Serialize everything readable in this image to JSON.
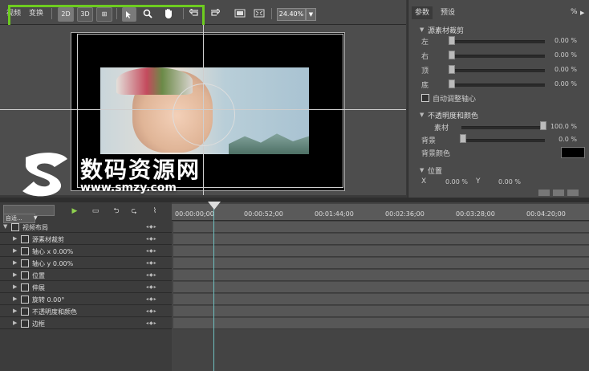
{
  "toolbar": {
    "tabs": [
      "视频",
      "变换"
    ],
    "buttons": [
      "2D",
      "3D",
      "⊞"
    ],
    "zoom": "24.40%"
  },
  "right_panel": {
    "tabs": [
      "参数",
      "预设"
    ],
    "pct_header": "%",
    "crop_section": "源素材裁剪",
    "crop_rows": [
      {
        "label": "左",
        "value": "0.00 %"
      },
      {
        "label": "右",
        "value": "0.00 %"
      },
      {
        "label": "顶",
        "value": "0.00 %"
      },
      {
        "label": "底",
        "value": "0.00 %"
      }
    ],
    "auto_center": "自动调整轴心",
    "opacity_section": "不透明度和颜色",
    "opacity_rows": [
      {
        "label": "素材",
        "value": "100.0 %"
      },
      {
        "label": "背景",
        "value": "0.0 %"
      }
    ],
    "bgcolor_label": "背景颜色",
    "position_section": "位置",
    "position_x_label": "X",
    "position_x_value": "0.00 %",
    "position_y_label": "Y",
    "position_y_value": "0.00 %"
  },
  "watermark": {
    "text": "数码资源网",
    "url": "www.smzy.com"
  },
  "timeline": {
    "mode": "自适...",
    "ruler": [
      "00:00:00;00",
      "00:00:52;00",
      "00:01:44;00",
      "00:02:36;00",
      "00:03:28;00",
      "00:04:20;00"
    ],
    "tracks": [
      "视频布局",
      "源素材裁剪",
      "轴心 x  0.00%",
      "轴心 y  0.00%",
      "位置",
      "伸展",
      "旋转  0.00°",
      "不透明度和颜色",
      "边框"
    ]
  }
}
